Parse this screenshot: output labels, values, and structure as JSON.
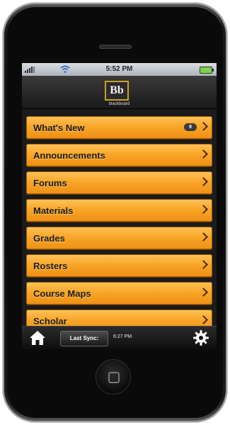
{
  "status_bar": {
    "time": "5:52 PM"
  },
  "header": {
    "logo_text": "Bb",
    "logo_caption": "blackboard"
  },
  "menu": {
    "items": [
      {
        "label": "What's New",
        "badge": "9"
      },
      {
        "label": "Announcements"
      },
      {
        "label": "Forums"
      },
      {
        "label": "Materials"
      },
      {
        "label": "Grades"
      },
      {
        "label": "Rosters"
      },
      {
        "label": "Course Maps"
      },
      {
        "label": "Scholar"
      }
    ]
  },
  "toolbar": {
    "sync_label": "Last Sync:",
    "sync_time": "6:27 PM"
  },
  "colors": {
    "accent": "#f8a729",
    "toolbar": "#1a1a1a",
    "logo_border": "#c9a227"
  },
  "icons": {
    "signal": "signal-icon",
    "wifi": "wifi-icon",
    "battery": "battery-icon",
    "home": "home-icon",
    "settings": "gear-icon",
    "chevron": "chevron-right-icon"
  }
}
